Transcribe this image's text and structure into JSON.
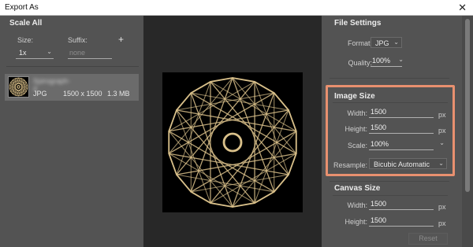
{
  "window": {
    "title": "Export As",
    "close_glyph": "✕"
  },
  "scale_all": {
    "header": "Scale All",
    "size_label": "Size:",
    "suffix_label": "Suffix:",
    "add_glyph": "+",
    "size_value": "1x",
    "suffix_placeholder": "none"
  },
  "asset": {
    "name": "Spirograph-4",
    "format": "JPG",
    "dimensions": "1500 x 1500",
    "file_size": "1.3 MB"
  },
  "file_settings": {
    "header": "File Settings",
    "format_label": "Format:",
    "format_value": "JPG",
    "quality_label": "Quality:",
    "quality_value": "100%"
  },
  "image_size": {
    "header": "Image Size",
    "width_label": "Width:",
    "width_value": "1500",
    "height_label": "Height:",
    "height_value": "1500",
    "scale_label": "Scale:",
    "scale_value": "100%",
    "resample_label": "Resample:",
    "resample_value": "Bicubic Automatic",
    "unit": "px"
  },
  "canvas_size": {
    "header": "Canvas Size",
    "width_label": "Width:",
    "width_value": "1500",
    "height_label": "Height:",
    "height_value": "1500",
    "unit": "px",
    "reset_label": "Reset"
  },
  "colors": {
    "highlight": "#e8906f",
    "spirograph": "#d9c08a",
    "panel": "#535353",
    "preview_bg": "#282828"
  },
  "icons": [
    "close-icon",
    "plus-icon",
    "chevron-down-icon",
    "spirograph-image"
  ]
}
